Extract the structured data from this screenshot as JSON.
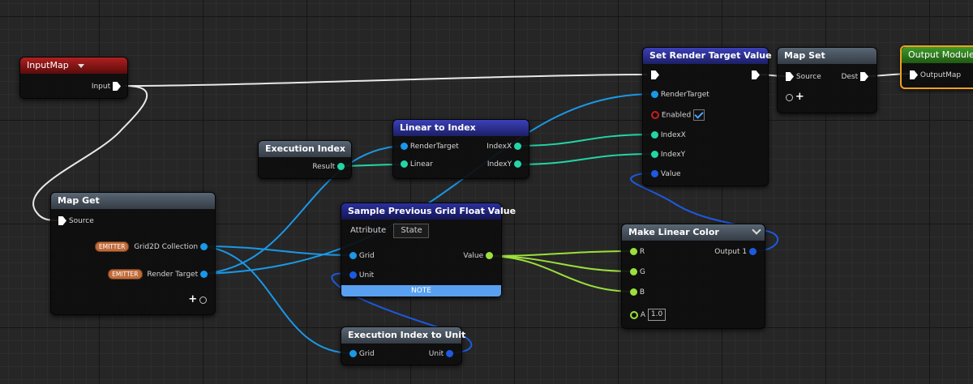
{
  "nodes": {
    "input_map": {
      "title": "InputMap",
      "input_label": "Input"
    },
    "map_get": {
      "title": "Map Get",
      "source_label": "Source",
      "grid_badge": "EMITTER",
      "grid_label": "Grid2D Collection",
      "rt_badge": "EMITTER",
      "rt_label": "Render Target"
    },
    "execution_index": {
      "title": "Execution Index",
      "result_label": "Result"
    },
    "linear_to_index": {
      "title": "Linear to Index",
      "render_target_label": "RenderTarget",
      "linear_label": "Linear",
      "index_x_label": "IndexX",
      "index_y_label": "IndexY"
    },
    "sample_grid": {
      "title": "Sample Previous Grid Float Value",
      "attribute_label": "Attribute",
      "attribute_value": "State",
      "grid_label": "Grid",
      "unit_label": "Unit",
      "value_label": "Value",
      "note_label": "NOTE"
    },
    "execution_index_to_unit": {
      "title": "Execution Index to Unit",
      "grid_label": "Grid",
      "unit_label": "Unit"
    },
    "set_render_target": {
      "title": "Set Render Target Value",
      "render_target_label": "RenderTarget",
      "enabled_label": "Enabled",
      "index_x_label": "IndexX",
      "index_y_label": "IndexY",
      "value_label": "Value"
    },
    "map_set": {
      "title": "Map Set",
      "source_label": "Source",
      "dest_label": "Dest"
    },
    "output_module": {
      "title": "Output Module",
      "output_map_label": "OutputMap"
    },
    "make_linear_color": {
      "title": "Make Linear Color",
      "r_label": "R",
      "g_label": "G",
      "b_label": "B",
      "a_label": "A",
      "a_value": "1.0",
      "output_label": "Output 1"
    }
  },
  "colors": {
    "exec_wire": "#e8e8e8",
    "grid_wire": "#1a98e8",
    "int_wire": "#22d6a6",
    "float_wire": "#9be03c",
    "unit_wire": "#1e5ae0",
    "selection": "#f0a020"
  }
}
